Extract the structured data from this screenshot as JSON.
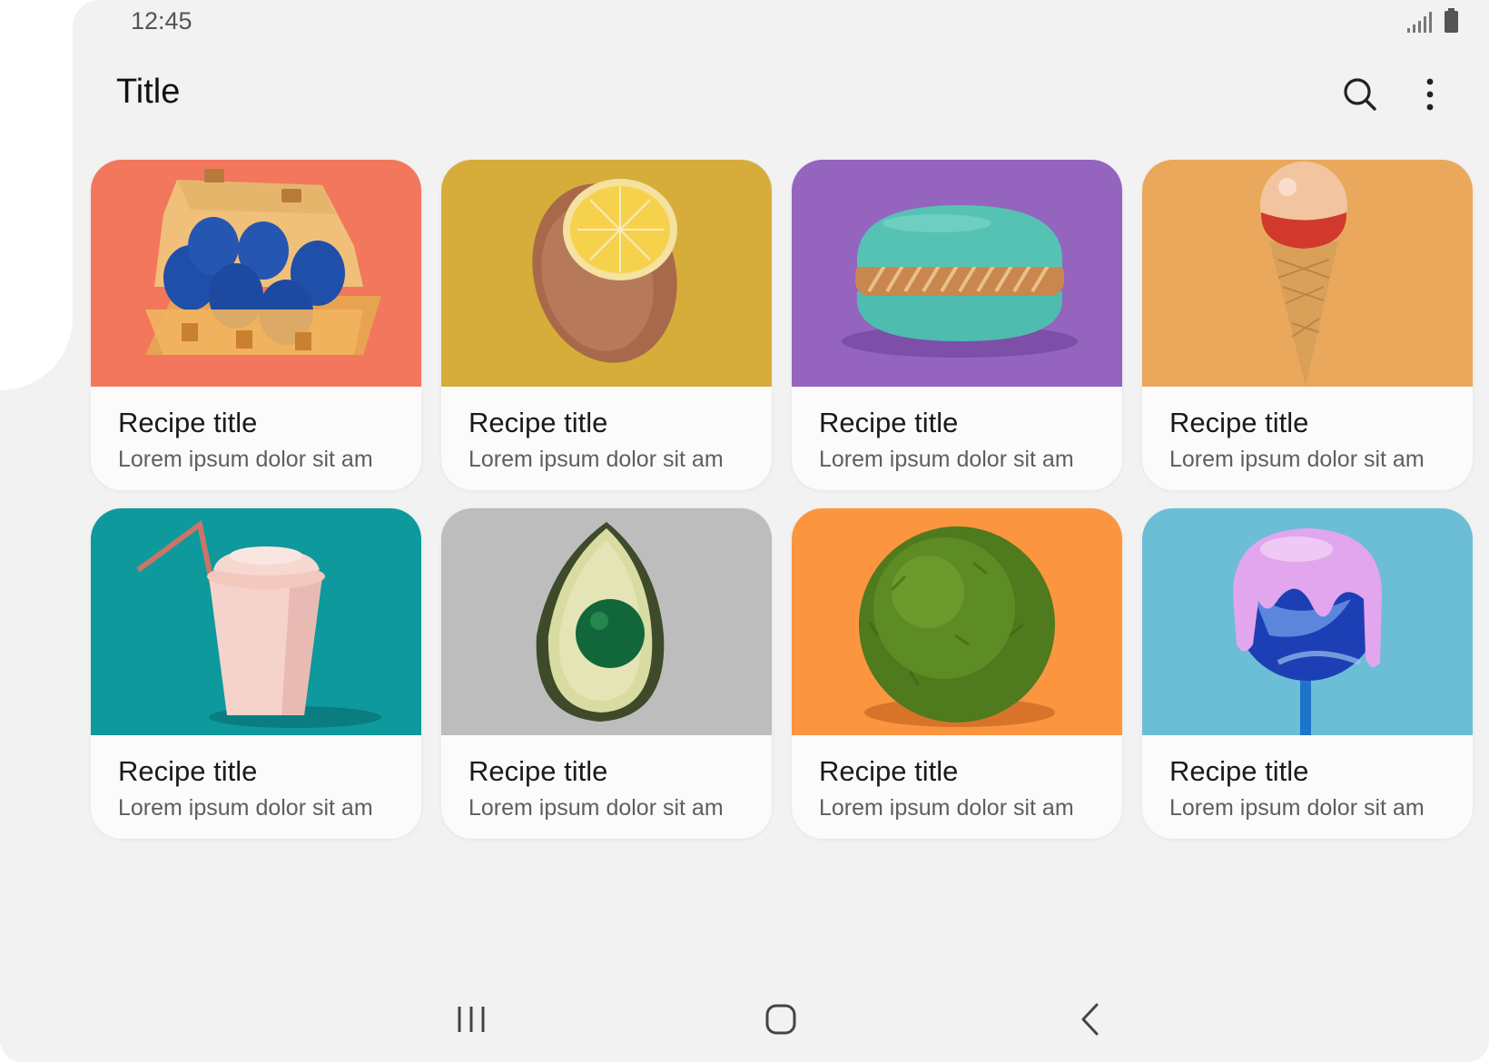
{
  "status_bar": {
    "time": "12:45"
  },
  "app_bar": {
    "title": "Title"
  },
  "cards": [
    {
      "title": "Recipe title",
      "subtitle": "Lorem ipsum dolor sit am",
      "image": "eggs-carton",
      "bg": "#f2775d"
    },
    {
      "title": "Recipe title",
      "subtitle": "Lorem ipsum dolor sit am",
      "image": "lemon",
      "bg": "#d6ad3a"
    },
    {
      "title": "Recipe title",
      "subtitle": "Lorem ipsum dolor sit am",
      "image": "macaron",
      "bg": "#9564bf"
    },
    {
      "title": "Recipe title",
      "subtitle": "Lorem ipsum dolor sit am",
      "image": "ice-cream-cone",
      "bg": "#eaa85c"
    },
    {
      "title": "Recipe title",
      "subtitle": "Lorem ipsum dolor sit am",
      "image": "paper-cup-straw",
      "bg": "#0e999c"
    },
    {
      "title": "Recipe title",
      "subtitle": "Lorem ipsum dolor sit am",
      "image": "avocado",
      "bg": "#bdbdbd"
    },
    {
      "title": "Recipe title",
      "subtitle": "Lorem ipsum dolor sit am",
      "image": "moss-ball",
      "bg": "#fb953f"
    },
    {
      "title": "Recipe title",
      "subtitle": "Lorem ipsum dolor sit am",
      "image": "lollipop",
      "bg": "#6bbed5"
    }
  ]
}
